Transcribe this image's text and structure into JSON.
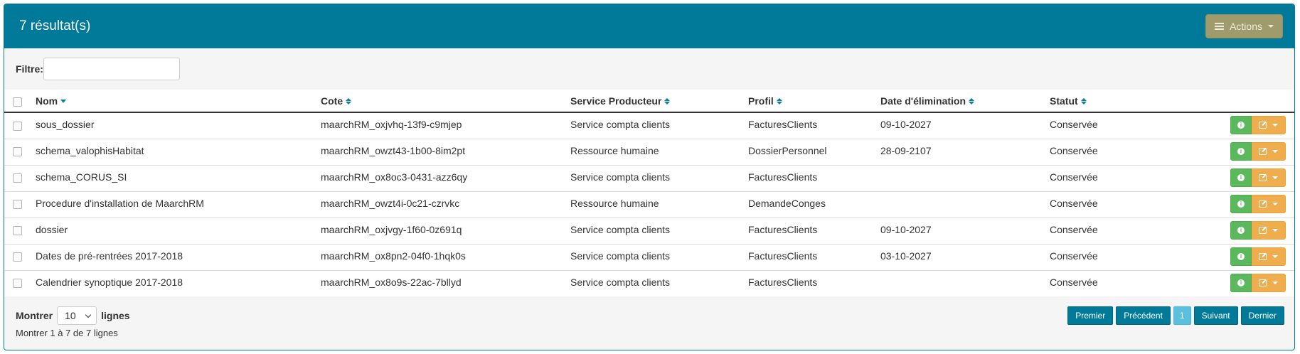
{
  "header": {
    "title": "7 résultat(s)",
    "actions_label": "Actions"
  },
  "filter": {
    "label": "Filtre:",
    "value": ""
  },
  "table": {
    "columns": {
      "nom": "Nom",
      "cote": "Cote",
      "service": "Service Producteur",
      "profil": "Profil",
      "date": "Date d'élimination",
      "statut": "Statut"
    },
    "rows": [
      {
        "nom": "sous_dossier",
        "cote": "maarchRM_oxjvhq-13f9-c9mjep",
        "service": "Service compta clients",
        "profil": "FacturesClients",
        "date": "09-10-2027",
        "statut": "Conservée"
      },
      {
        "nom": "schema_valophisHabitat",
        "cote": "maarchRM_owzt43-1b00-8im2pt",
        "service": "Ressource humaine",
        "profil": "DossierPersonnel",
        "date": "28-09-2107",
        "statut": "Conservée"
      },
      {
        "nom": "schema_CORUS_SI",
        "cote": "maarchRM_ox8oc3-0431-azz6qy",
        "service": "Service compta clients",
        "profil": "FacturesClients",
        "date": "",
        "statut": "Conservée"
      },
      {
        "nom": "Procedure d'installation de MaarchRM",
        "cote": "maarchRM_owzt4i-0c21-czrvkc",
        "service": "Ressource humaine",
        "profil": "DemandeConges",
        "date": "",
        "statut": "Conservée"
      },
      {
        "nom": "dossier",
        "cote": "maarchRM_oxjvgy-1f60-0z691q",
        "service": "Service compta clients",
        "profil": "FacturesClients",
        "date": "09-10-2027",
        "statut": "Conservée"
      },
      {
        "nom": "Dates de pré-rentrées 2017-2018",
        "cote": "maarchRM_ox8pn2-04f0-1hqk0s",
        "service": "Service compta clients",
        "profil": "FacturesClients",
        "date": "03-10-2027",
        "statut": "Conservée"
      },
      {
        "nom": "Calendrier synoptique 2017-2018",
        "cote": "maarchRM_ox8o9s-22ac-7bllyd",
        "service": "Service compta clients",
        "profil": "FacturesClients",
        "date": "",
        "statut": "Conservée"
      }
    ]
  },
  "footer": {
    "show_label": "Montrer",
    "page_size": "10",
    "lines_label": "lignes",
    "info": "Montrer 1 à 7 de 7 lignes",
    "pager": {
      "first": "Premier",
      "prev": "Précédent",
      "current": "1",
      "next": "Suivant",
      "last": "Dernier"
    }
  },
  "colors": {
    "primary": "#007a98",
    "success": "#5cb85c",
    "warning": "#f0ad4e",
    "actions": "#a09b6c"
  },
  "icons": {
    "actions": "hamburger-icon",
    "info": "info-icon",
    "edit": "edit-icon"
  }
}
